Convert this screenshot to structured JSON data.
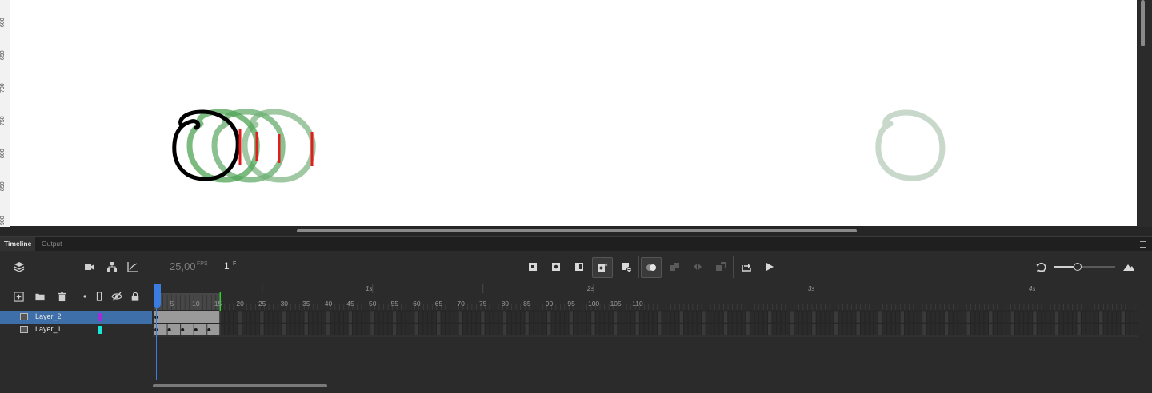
{
  "panel_tabs": [
    "Timeline",
    "Output"
  ],
  "toolbar": {
    "fps_value": "25,00",
    "fps_unit": "FPS",
    "frame_value": "1",
    "frame_unit": "F"
  },
  "vertical_ruler": [
    "600",
    "650",
    "700",
    "750",
    "800",
    "850",
    "900"
  ],
  "ruler": {
    "seconds": [
      "1s",
      "2s",
      "3s",
      "4s"
    ],
    "frame_numbers": [
      "5",
      "10",
      "15",
      "20",
      "25",
      "30",
      "35",
      "40",
      "45",
      "50",
      "55",
      "60",
      "65",
      "70",
      "75",
      "80",
      "85",
      "90",
      "95",
      "100",
      "105",
      "110"
    ]
  },
  "current_frame": 1,
  "onion_skin_end_frame": 15,
  "layers": [
    {
      "name": "Layer_2",
      "color": "#9b30d9",
      "selected": true
    },
    {
      "name": "Layer_1",
      "color": "#19e6d8",
      "selected": false
    }
  ],
  "layer_2_span_frames": [
    1,
    15
  ],
  "layer_1_keyframes": [
    1,
    4,
    7,
    10,
    13
  ],
  "layer_1_span_frames": [
    1,
    15
  ],
  "colors": {
    "accent_blue": "#3a7ce0",
    "selected_layer": "#3f6fa8",
    "onion_green": "#2f9a3a",
    "onion_faded": "#a9c8ad",
    "stroke_red": "#e01e1e"
  },
  "icons": [
    "layers-icon",
    "camera-icon",
    "hierarchy-icon",
    "graph-icon",
    "insert-keyframe-icon",
    "blank-keyframe-icon",
    "clear-keyframe-icon",
    "auto-keyframe-icon",
    "remove-keyframe-icon",
    "onion-skin-icon",
    "loop-icon",
    "play-icon",
    "undo-icon",
    "zoom-mountain-icon",
    "add-layer-icon",
    "folder-icon",
    "trash-icon",
    "highlight-dot-icon",
    "outline-icon",
    "visibility-icon",
    "lock-icon"
  ]
}
